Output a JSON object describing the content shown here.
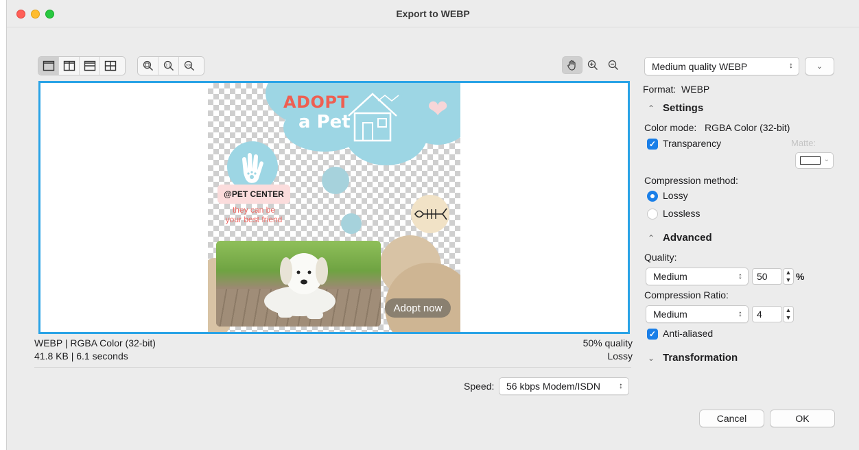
{
  "window": {
    "title": "Export to WEBP"
  },
  "toolbar": {
    "view_icons": [
      "single-view-icon",
      "split-vertical-icon",
      "split-horizontal-icon",
      "quad-view-icon"
    ],
    "zoom_icons": [
      "zoom-fit-icon",
      "zoom-actual-icon",
      "zoom-100-icon"
    ],
    "nav_icons": [
      "hand-tool-icon",
      "zoom-in-icon",
      "zoom-out-icon"
    ]
  },
  "artwork": {
    "title_line1": "ADOPT",
    "title_line2": "a Pet",
    "badge": "@PET CENTER",
    "tagline_line1": "they can be",
    "tagline_line2": "your best friend",
    "cta": "Adopt now",
    "accent_color": "#ee5f52",
    "sky_color": "#9dd6e4"
  },
  "status": {
    "format_info": "WEBP  |  RGBA Color (32-bit)",
    "size_time": "41.8 KB  |  6.1 seconds",
    "quality": "50% quality",
    "mode": "Lossy",
    "speed_label": "Speed:",
    "speed_value": "56 kbps Modem/ISDN"
  },
  "panel": {
    "preset": "Medium quality WEBP",
    "format_label": "Format:",
    "format_value": "WEBP",
    "settings_title": "Settings",
    "color_mode_label": "Color mode:",
    "color_mode_value": "RGBA Color (32-bit)",
    "transparency_label": "Transparency",
    "transparency_checked": true,
    "matte_label": "Matte:",
    "compression_method_label": "Compression method:",
    "lossy_label": "Lossy",
    "lossless_label": "Lossless",
    "selected_method": "Lossy",
    "advanced_title": "Advanced",
    "quality_label": "Quality:",
    "quality_preset": "Medium",
    "quality_value": "50",
    "quality_unit": "%",
    "ratio_label": "Compression Ratio:",
    "ratio_preset": "Medium",
    "ratio_value": "4",
    "antialias_label": "Anti-aliased",
    "antialias_checked": true,
    "transformation_title": "Transformation"
  },
  "buttons": {
    "cancel": "Cancel",
    "ok": "OK"
  },
  "colors": {
    "selection_blue": "#1a7fe8",
    "preview_border": "#2aa3e6"
  }
}
